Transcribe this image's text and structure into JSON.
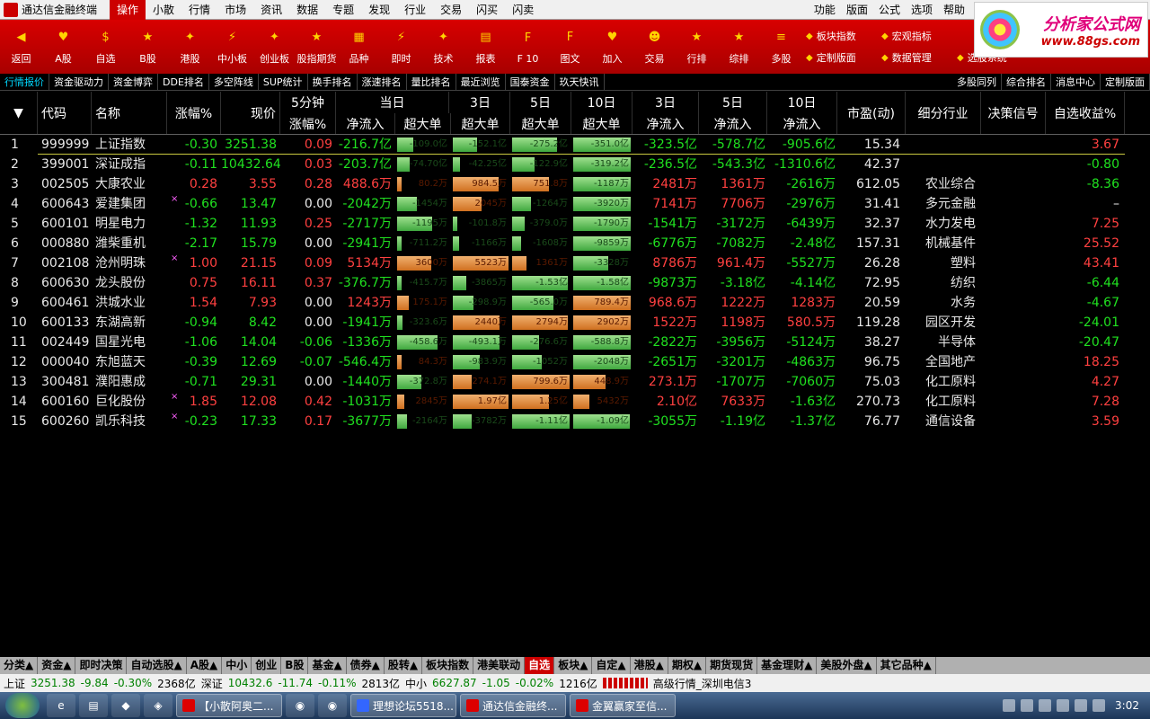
{
  "menubar": {
    "app_title": "通达信金融终端",
    "items": [
      "操作",
      "小散",
      "行情",
      "市场",
      "资讯",
      "数据",
      "专题",
      "发现",
      "行业",
      "交易",
      "闪买",
      "闪卖"
    ],
    "active": "操作",
    "right_items": [
      "功能",
      "版面",
      "公式",
      "选项",
      "帮助"
    ]
  },
  "brand": {
    "line1": "分析家公式网",
    "line2": "www.88gs.com"
  },
  "toolbar": {
    "items": [
      {
        "label": "返回",
        "icon": "back-arrow-icon"
      },
      {
        "label": "A股",
        "icon": "heart-icon"
      },
      {
        "label": "自选",
        "icon": "dollar-icon"
      },
      {
        "label": "B股",
        "icon": "star-icon"
      },
      {
        "label": "港股",
        "icon": "leaf-icon"
      },
      {
        "label": "中小板",
        "icon": "bolt-icon"
      },
      {
        "label": "创业板",
        "icon": "leaf-icon"
      },
      {
        "label": "股指期货",
        "icon": "star-icon"
      },
      {
        "label": "品种",
        "icon": "blocks-icon"
      },
      {
        "label": "即时",
        "icon": "bolt-icon"
      },
      {
        "label": "技术",
        "icon": "leaf-icon"
      },
      {
        "label": "报表",
        "icon": "flag-icon"
      },
      {
        "label": "F 10",
        "icon": "f10-icon"
      },
      {
        "label": "图文",
        "icon": "f10-icon"
      },
      {
        "label": "加入",
        "icon": "heart-icon"
      },
      {
        "label": "交易",
        "icon": "person-icon"
      },
      {
        "label": "行排",
        "icon": "star-icon"
      },
      {
        "label": "综排",
        "icon": "star-icon"
      },
      {
        "label": "多股",
        "icon": "multi-icon"
      }
    ],
    "right": [
      "板块指数",
      "宏观指标",
      "",
      "定制版面",
      "数据管理",
      "选股系统"
    ]
  },
  "subtabs": {
    "left": [
      "行情报价",
      "资金驱动力",
      "资金博弈",
      "DDE排名",
      "多空阵线",
      "SUP统计",
      "换手排名",
      "涨速排名",
      "量比排名",
      "最近浏览",
      "国泰资金",
      "玖天快讯"
    ],
    "active": "行情报价",
    "right": [
      "多股同列",
      "综合排名",
      "消息中心",
      "定制版面"
    ]
  },
  "header": {
    "code": "代码",
    "name": "名称",
    "chg": "涨幅%",
    "price": "现价",
    "min5_top": "5分钟",
    "min5_bot": "涨幅%",
    "today": "当日",
    "net_in": "净流入",
    "super": "超大单",
    "d3": "3日",
    "d5": "5日",
    "d10": "10日",
    "pe": "市盈(动)",
    "industry": "细分行业",
    "signal": "决策信号",
    "selfgain": "自选收益%"
  },
  "rows": [
    {
      "n": "1",
      "code": "999999",
      "name": "上证指数",
      "chg": "-0.30",
      "price": "3251.38",
      "m5": "0.09",
      "net": "-216.7亿",
      "sb": "-109.0亿",
      "s3": "-152.1亿",
      "s5": "-275.2亿",
      "s10": "-351.0亿",
      "n3": "-323.5亿",
      "n5": "-578.7亿",
      "n10": "-905.6亿",
      "pe": "15.34",
      "ind": "",
      "gain": "3.67",
      "star": false
    },
    {
      "n": "2",
      "code": "399001",
      "name": "深证成指",
      "chg": "-0.11",
      "price": "10432.64",
      "m5": "0.03",
      "net": "-203.7亿",
      "sb": "-74.70亿",
      "s3": "-42.25亿",
      "s5": "-122.9亿",
      "s10": "-319.2亿",
      "n3": "-236.5亿",
      "n5": "-543.3亿",
      "n10": "-1310.6亿",
      "pe": "42.37",
      "ind": "",
      "gain": "-0.80",
      "star": false
    },
    {
      "n": "3",
      "code": "002505",
      "name": "大康农业",
      "chg": "0.28",
      "price": "3.55",
      "m5": "0.28",
      "net": "488.6万",
      "sb": "80.2万",
      "s3": "984.5万",
      "s5": "751.8万",
      "s10": "-1187万",
      "n3": "2481万",
      "n5": "1361万",
      "n10": "-2616万",
      "pe": "612.05",
      "ind": "农业综合",
      "gain": "-8.36",
      "star": false
    },
    {
      "n": "4",
      "code": "600643",
      "name": "爱建集团",
      "chg": "-0.66",
      "price": "13.47",
      "m5": "0.00",
      "net": "-2042万",
      "sb": "-1454万",
      "s3": "2045万",
      "s5": "-1264万",
      "s10": "-3920万",
      "n3": "7141万",
      "n5": "7706万",
      "n10": "-2976万",
      "pe": "31.41",
      "ind": "多元金融",
      "gain": "–",
      "star": true
    },
    {
      "n": "5",
      "code": "600101",
      "name": "明星电力",
      "chg": "-1.32",
      "price": "11.93",
      "m5": "0.25",
      "net": "-2717万",
      "sb": "-1195万",
      "s3": "-101.8万",
      "s5": "-379.0万",
      "s10": "-1790万",
      "n3": "-1541万",
      "n5": "-3172万",
      "n10": "-6439万",
      "pe": "32.37",
      "ind": "水力发电",
      "gain": "7.25",
      "star": false
    },
    {
      "n": "6",
      "code": "000880",
      "name": "潍柴重机",
      "chg": "-2.17",
      "price": "15.79",
      "m5": "0.00",
      "net": "-2941万",
      "sb": "-711.2万",
      "s3": "-1166万",
      "s5": "-1608万",
      "s10": "-9859万",
      "n3": "-6776万",
      "n5": "-7082万",
      "n10": "-2.48亿",
      "pe": "157.31",
      "ind": "机械基件",
      "gain": "25.52",
      "star": false
    },
    {
      "n": "7",
      "code": "002108",
      "name": "沧州明珠",
      "chg": "1.00",
      "price": "21.15",
      "m5": "0.09",
      "net": "5134万",
      "sb": "3600万",
      "s3": "5523万",
      "s5": "1361万",
      "s10": "-3328万",
      "n3": "8786万",
      "n5": "961.4万",
      "n10": "-5527万",
      "pe": "26.28",
      "ind": "塑料",
      "gain": "43.41",
      "star": true
    },
    {
      "n": "8",
      "code": "600630",
      "name": "龙头股份",
      "chg": "0.75",
      "price": "16.11",
      "m5": "0.37",
      "net": "-376.7万",
      "sb": "-415.7万",
      "s3": "-3865万",
      "s5": "-1.53亿",
      "s10": "-1.58亿",
      "n3": "-9873万",
      "n5": "-3.18亿",
      "n10": "-4.14亿",
      "pe": "72.95",
      "ind": "纺织",
      "gain": "-6.44",
      "star": false
    },
    {
      "n": "9",
      "code": "600461",
      "name": "洪城水业",
      "chg": "1.54",
      "price": "7.93",
      "m5": "0.00",
      "net": "1243万",
      "sb": "175.1万",
      "s3": "-298.9万",
      "s5": "-565.0万",
      "s10": "789.4万",
      "n3": "968.6万",
      "n5": "1222万",
      "n10": "1283万",
      "pe": "20.59",
      "ind": "水务",
      "gain": "-4.67",
      "star": false
    },
    {
      "n": "10",
      "code": "600133",
      "name": "东湖高新",
      "chg": "-0.94",
      "price": "8.42",
      "m5": "0.00",
      "net": "-1941万",
      "sb": "-323.6万",
      "s3": "2440万",
      "s5": "2794万",
      "s10": "2902万",
      "n3": "1522万",
      "n5": "1198万",
      "n10": "580.5万",
      "pe": "119.28",
      "ind": "园区开发",
      "gain": "-24.01",
      "star": false
    },
    {
      "n": "11",
      "code": "002449",
      "name": "国星光电",
      "chg": "-1.06",
      "price": "14.04",
      "m5": "-0.06",
      "net": "-1336万",
      "sb": "-458.6万",
      "s3": "-493.1万",
      "s5": "-276.6万",
      "s10": "-588.8万",
      "n3": "-2822万",
      "n5": "-3956万",
      "n10": "-5124万",
      "pe": "38.27",
      "ind": "半导体",
      "gain": "-20.47",
      "star": false
    },
    {
      "n": "12",
      "code": "000040",
      "name": "东旭蓝天",
      "chg": "-0.39",
      "price": "12.69",
      "m5": "-0.07",
      "net": "-546.4万",
      "sb": "84.3万",
      "s3": "-983.9万",
      "s5": "-1052万",
      "s10": "-2048万",
      "n3": "-2651万",
      "n5": "-3201万",
      "n10": "-4863万",
      "pe": "96.75",
      "ind": "全国地产",
      "gain": "18.25",
      "star": false
    },
    {
      "n": "13",
      "code": "300481",
      "name": "濮阳惠成",
      "chg": "-0.71",
      "price": "29.31",
      "m5": "0.00",
      "net": "-1440万",
      "sb": "-372.8万",
      "s3": "274.1万",
      "s5": "799.6万",
      "s10": "448.9万",
      "n3": "273.1万",
      "n5": "-1707万",
      "n10": "-7060万",
      "pe": "75.03",
      "ind": "化工原料",
      "gain": "4.27",
      "star": false
    },
    {
      "n": "14",
      "code": "600160",
      "name": "巨化股份",
      "chg": "1.85",
      "price": "12.08",
      "m5": "0.42",
      "net": "-1031万",
      "sb": "2845万",
      "s3": "1.97亿",
      "s5": "1.25亿",
      "s10": "5432万",
      "n3": "2.10亿",
      "n5": "7633万",
      "n10": "-1.63亿",
      "pe": "270.73",
      "ind": "化工原料",
      "gain": "7.28",
      "star": true
    },
    {
      "n": "15",
      "code": "600260",
      "name": "凯乐科技",
      "chg": "-0.23",
      "price": "17.33",
      "m5": "0.17",
      "net": "-3677万",
      "sb": "-2164万",
      "s3": "-3782万",
      "s5": "-1.11亿",
      "s10": "-1.09亿",
      "n3": "-3055万",
      "n5": "-1.19亿",
      "n10": "-1.37亿",
      "pe": "76.77",
      "ind": "通信设备",
      "gain": "3.59",
      "star": true
    }
  ],
  "btabs": [
    "分类▲",
    "资金▲",
    "即时决策",
    "自动选股▲",
    "A股▲",
    "中小",
    "创业",
    "B股",
    "基金▲",
    "债券▲",
    "股转▲",
    "板块指数",
    "港美联动",
    "自选",
    "板块▲",
    "自定▲",
    "港股▲",
    "期权▲",
    "期货现货",
    "基金理财▲",
    "美股外盘▲",
    "其它品种▲"
  ],
  "btabs_active": "自选",
  "status": {
    "sh_label": "上证",
    "sh_val": "3251.38",
    "sh_chg": "-9.84",
    "sh_pct": "-0.30%",
    "sh_amt": "2368亿",
    "sz_label": "深证",
    "sz_val": "10432.6",
    "sz_chg": "-11.74",
    "sz_pct": "-0.11%",
    "sz_amt": "2813亿",
    "zx_label": "中小",
    "zx_val": "6627.87",
    "zx_chg": "-1.05",
    "zx_pct": "-0.02%",
    "zx_amt": "1216亿",
    "server": "高级行情_深圳电信3"
  },
  "taskbar": {
    "tasks": [
      "【小散阿奥二...",
      "理想论坛5518...",
      "通达信金融终...",
      "金翼赢家至信..."
    ],
    "clock": "3:02"
  }
}
